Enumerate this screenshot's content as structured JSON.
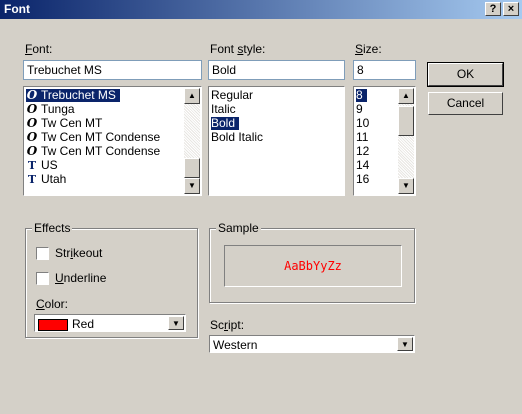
{
  "window": {
    "title": "Font",
    "help_label": "?",
    "close_label": "×"
  },
  "font": {
    "label": "Font:",
    "value": "Trebuchet MS",
    "items": [
      {
        "name": "Trebuchet MS",
        "icon": "O",
        "icon_type": "opentype",
        "selected": true
      },
      {
        "name": "Tunga",
        "icon": "O",
        "icon_type": "opentype",
        "selected": false
      },
      {
        "name": "Tw Cen MT",
        "icon": "O",
        "icon_type": "opentype",
        "selected": false
      },
      {
        "name": "Tw Cen MT Condense",
        "icon": "O",
        "icon_type": "opentype",
        "selected": false
      },
      {
        "name": "Tw Cen MT Condense",
        "icon": "O",
        "icon_type": "opentype",
        "selected": false
      },
      {
        "name": "US",
        "icon": "T",
        "icon_type": "truetype",
        "selected": false
      },
      {
        "name": "Utah",
        "icon": "T",
        "icon_type": "truetype",
        "selected": false
      }
    ]
  },
  "style": {
    "label": "Font style:",
    "value": "Bold",
    "items": [
      {
        "name": "Regular",
        "selected": false
      },
      {
        "name": "Italic",
        "selected": false
      },
      {
        "name": "Bold",
        "selected": true
      },
      {
        "name": "Bold Italic",
        "selected": false
      }
    ]
  },
  "size": {
    "label": "Size:",
    "value": "8",
    "items": [
      {
        "name": "8",
        "selected": true
      },
      {
        "name": "9",
        "selected": false
      },
      {
        "name": "10",
        "selected": false
      },
      {
        "name": "11",
        "selected": false
      },
      {
        "name": "12",
        "selected": false
      },
      {
        "name": "14",
        "selected": false
      },
      {
        "name": "16",
        "selected": false
      }
    ]
  },
  "buttons": {
    "ok": "OK",
    "cancel": "Cancel"
  },
  "effects": {
    "title": "Effects",
    "strikeout": "Strikeout",
    "underline": "Underline",
    "color_label": "Color:",
    "color_value": "Red",
    "color_hex": "#ff0000"
  },
  "sample": {
    "title": "Sample",
    "text": "AaBbYyZz",
    "text_color": "#ff0000"
  },
  "script": {
    "label": "Script:",
    "value": "Western"
  },
  "colors": {
    "selection": "#0a246a",
    "dialog_bg": "#d4d0c8",
    "title_start": "#0a246a",
    "title_end": "#a6caf0"
  }
}
